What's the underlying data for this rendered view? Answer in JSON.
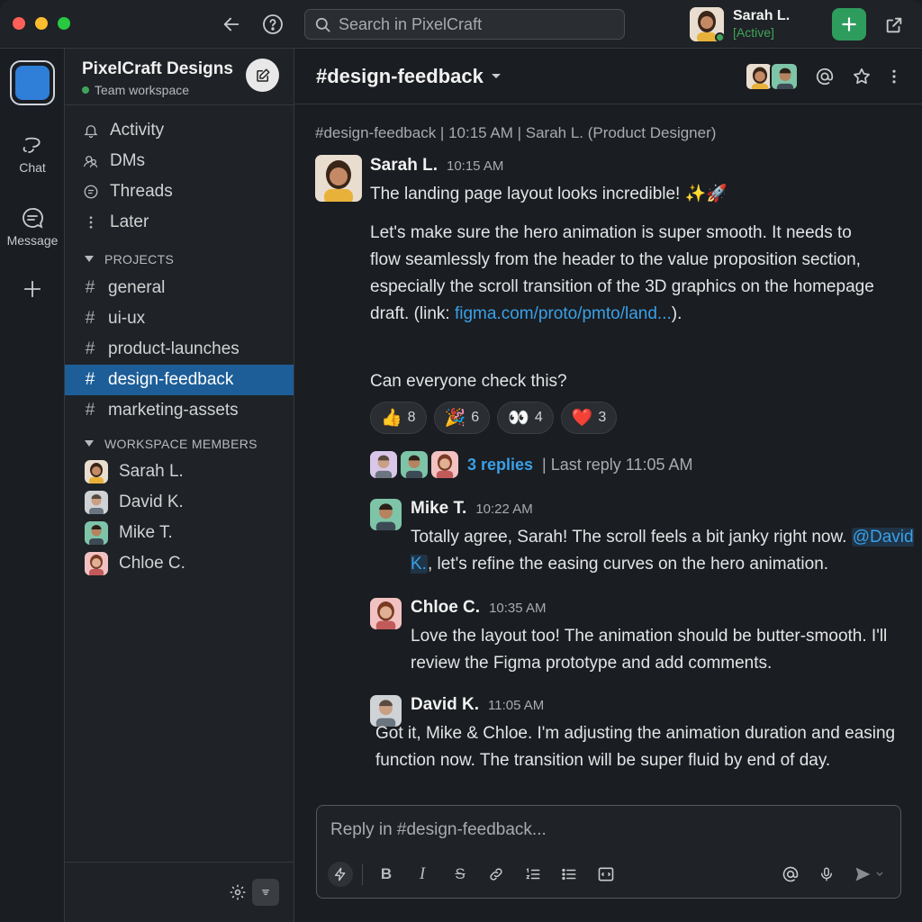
{
  "titlebar": {
    "search_placeholder": "Search in PixelCraft",
    "user_name": "Sarah L.",
    "user_status": "[Active]",
    "traffic_colors": [
      "#fe5f57",
      "#febc2e",
      "#28c840"
    ]
  },
  "rail": {
    "items": [
      {
        "label": "Chat",
        "icon": "chat-icon"
      },
      {
        "label": "Message",
        "icon": "message-icon"
      }
    ]
  },
  "sidebar": {
    "workspace_name": "PixelCraft Designs",
    "workspace_sub": "Team workspace",
    "nav": [
      {
        "label": "Activity",
        "icon": "bell-icon"
      },
      {
        "label": "DMs",
        "icon": "dms-icon"
      },
      {
        "label": "Threads",
        "icon": "threads-icon"
      },
      {
        "label": "Later",
        "icon": "more-vertical-icon"
      }
    ],
    "projects_header": "PROJECTS",
    "channels": [
      {
        "label": "general",
        "active": false
      },
      {
        "label": "ui-ux",
        "active": false
      },
      {
        "label": "product-launches",
        "active": false
      },
      {
        "label": "design-feedback",
        "active": true
      },
      {
        "label": "marketing-assets",
        "active": false
      }
    ],
    "members_header": "WORKSPACE MEMBERS",
    "members": [
      {
        "name": "Sarah L.",
        "color": "#c98a6b"
      },
      {
        "name": "David K.",
        "color": "#8d9aa6"
      },
      {
        "name": "Mike T.",
        "color": "#5aa58a"
      },
      {
        "name": "Chloe C.",
        "color": "#d48a8a"
      }
    ]
  },
  "channel": {
    "title": "#design-feedback",
    "meta": "#design-feedback | 10:15 AM | Sarah L. (Product Designer)"
  },
  "message": {
    "author": "Sarah L.",
    "time": "10:15 AM",
    "line1": "The landing page layout looks incredible! ✨🚀",
    "para1": "Let's make sure the hero animation is super smooth. It needs to flow seamlessly from the header to the value proposition section, especially the scroll transition of the 3D graphics on the homepage draft. (link: ",
    "link": "figma.com/proto/pmto/land...",
    "para1_end": ").",
    "para2": "Can everyone check this?",
    "reactions": [
      {
        "emoji": "👍",
        "count": "8"
      },
      {
        "emoji": "🎉",
        "count": "6"
      },
      {
        "emoji": "👀",
        "count": "4"
      },
      {
        "emoji": "❤️",
        "count": "3"
      }
    ],
    "replies_label": "3 replies",
    "last_reply": "| Last reply 11:05 AM"
  },
  "replies": [
    {
      "author": "Mike T.",
      "time": "10:22 AM",
      "mention": "@David K.",
      "text_before": "Totally agree, Sarah! The scroll feels a bit janky right now. ",
      "text_after": ", let's refine the easing curves on the hero animation."
    },
    {
      "author": "Chloe C.",
      "time": "10:35 AM",
      "text": "Love the layout too! The animation should be butter-smooth. I'll review the Figma prototype and add comments."
    },
    {
      "author": "David K.",
      "time": "11:05 AM",
      "text": "Got it, Mike & Chloe. I'm adjusting the animation duration and easing function now. The transition will be super fluid by end of day."
    }
  ],
  "composer": {
    "placeholder": "Reply in #design-feedback..."
  }
}
